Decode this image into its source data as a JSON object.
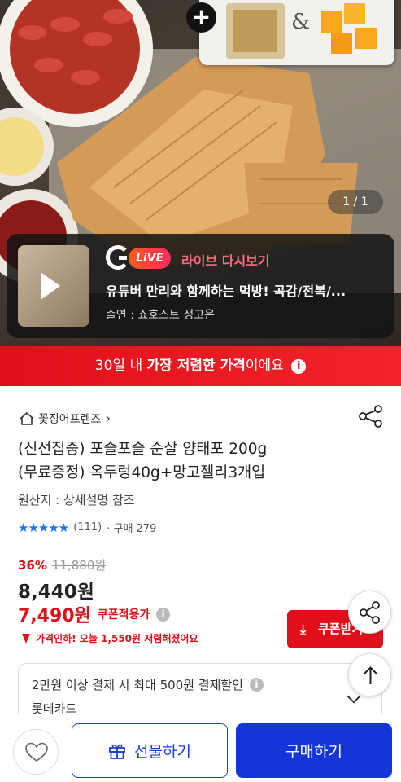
{
  "hero": {
    "image_counter": "1 / 1",
    "live": {
      "logo_letter": "G",
      "badge": "LiVE",
      "replay_label": "라이브 다시보기",
      "title": "유튜버 만리와 함께하는 먹방! 곡감/전복/...",
      "host": "출연 : 쇼호스트 정고은"
    },
    "bundle_plus": "+",
    "bundle_amp": "&"
  },
  "promo": {
    "prefix": "30일 내 ",
    "bold": "가장 저렴한 가격",
    "suffix": "이에요",
    "info": "i"
  },
  "product": {
    "store_name": "꽃징어프렌즈",
    "store_chevron": "›",
    "title_line1": "(신선집중) 포슬포슬 순살 양태포 200g",
    "title_line2": "(무료증정) 옥두렁40g+망고젤리3개입",
    "origin": "원산지 : 상세설명 참조",
    "stars": "★★★★★",
    "reviews": "(111)",
    "purchases": "· 구매 279",
    "discount": "36%",
    "original_price": "11,880원",
    "price": "8,440원",
    "coupon_price": "7,490원",
    "coupon_applied": "쿠폰적용가",
    "price_drop": "가격인하! 오늘 1,550원 저렴해졌어요",
    "coupon_button": "쿠폰받기",
    "coupon_button_icon": "⤓"
  },
  "card_offer": {
    "text": "2만원 이상 결제 시 최대 500원 결제할인",
    "card": "롯데카드",
    "info": "i"
  },
  "bottom": {
    "gift_label": "선물하기",
    "buy_label": "구매하기"
  },
  "colors": {
    "accent_red": "#e0101a",
    "brand_blue": "#1435d8",
    "star_blue": "#1e74e8",
    "live_pink": "#ff6a7a"
  }
}
